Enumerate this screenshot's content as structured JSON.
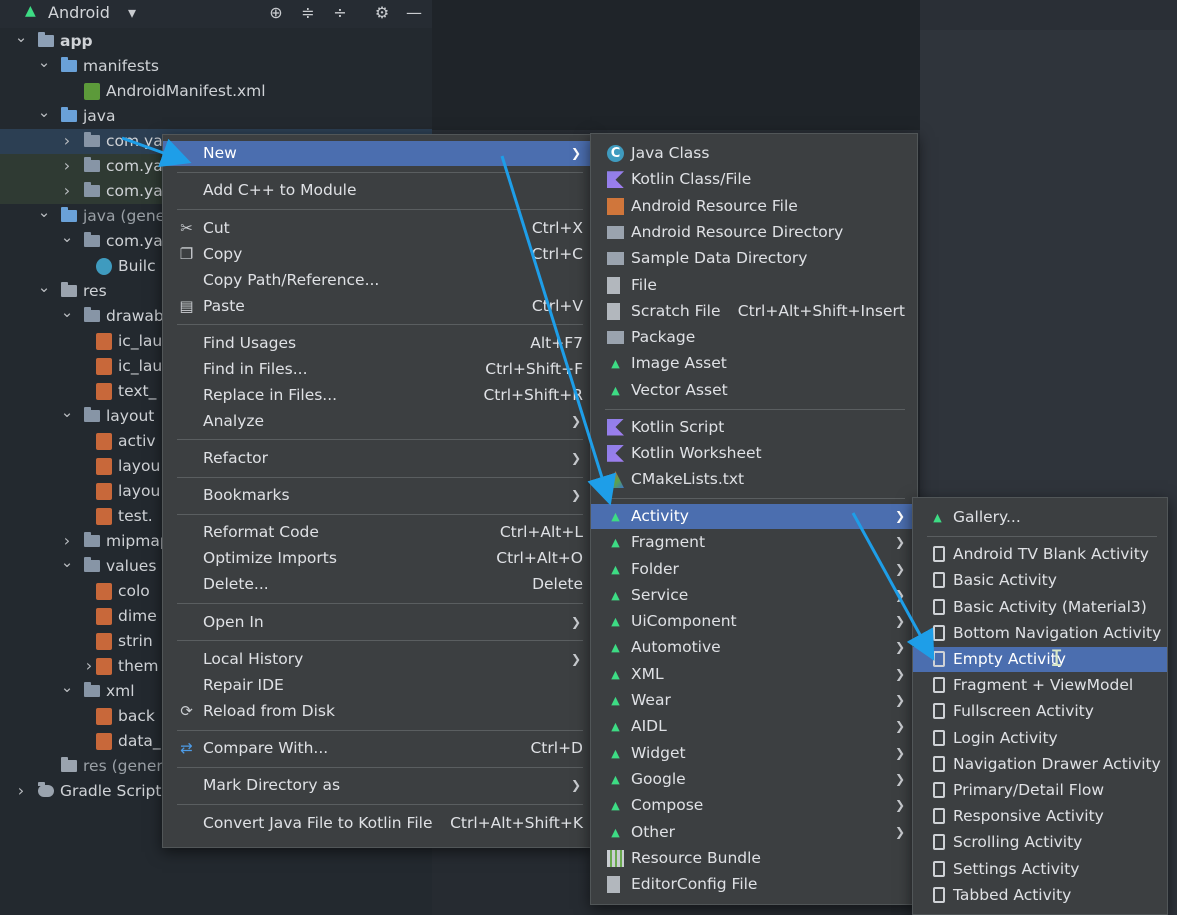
{
  "toolbar": {
    "title": "Android",
    "icons": [
      "android-icon",
      "chevron-down-icon",
      "locate-icon",
      "expand-all-icon",
      "collapse-all-icon",
      "gear-icon",
      "minimize-icon"
    ]
  },
  "tree": [
    {
      "label": "app",
      "level": 0
    },
    {
      "label": "manifests",
      "level": 1
    },
    {
      "label": "AndroidManifest.xml",
      "level": 2
    },
    {
      "label": "java",
      "level": 1
    },
    {
      "label": "com.yar",
      "level": 2
    },
    {
      "label": "com.yar",
      "level": 2
    },
    {
      "label": "com.yar",
      "level": 2
    },
    {
      "label": "java (genera",
      "level": 1
    },
    {
      "label": "com.yar",
      "level": 2
    },
    {
      "label": "Builc",
      "level": 3
    },
    {
      "label": "res",
      "level": 1
    },
    {
      "label": "drawabl",
      "level": 2
    },
    {
      "label": "ic_lau",
      "level": 3
    },
    {
      "label": "ic_lau",
      "level": 3
    },
    {
      "label": "text_",
      "level": 3
    },
    {
      "label": "layout",
      "level": 2
    },
    {
      "label": "activ",
      "level": 3
    },
    {
      "label": "layou",
      "level": 3
    },
    {
      "label": "layou",
      "level": 3
    },
    {
      "label": "test.",
      "level": 3
    },
    {
      "label": "mipmap",
      "level": 2
    },
    {
      "label": "values",
      "level": 2
    },
    {
      "label": "colo",
      "level": 3
    },
    {
      "label": "dime",
      "level": 3
    },
    {
      "label": "strin",
      "level": 3
    },
    {
      "label": "them",
      "level": 3
    },
    {
      "label": "xml",
      "level": 2
    },
    {
      "label": "back",
      "level": 3
    },
    {
      "label": "data_",
      "level": 3
    },
    {
      "label": "res (genera",
      "level": 1
    },
    {
      "label": "Gradle Scripts",
      "level": 0
    }
  ],
  "menu1": {
    "items": [
      {
        "label": "New",
        "submenu": true,
        "selected": true
      },
      {
        "label": "Add C++ to Module"
      },
      {
        "label": "Cut",
        "shortcut": "Ctrl+X",
        "icon": "scissors-icon"
      },
      {
        "label": "Copy",
        "shortcut": "Ctrl+C",
        "icon": "copy-icon"
      },
      {
        "label": "Copy Path/Reference..."
      },
      {
        "label": "Paste",
        "shortcut": "Ctrl+V",
        "icon": "paste-icon"
      },
      {
        "label": "Find Usages",
        "shortcut": "Alt+F7"
      },
      {
        "label": "Find in Files...",
        "shortcut": "Ctrl+Shift+F"
      },
      {
        "label": "Replace in Files...",
        "shortcut": "Ctrl+Shift+R"
      },
      {
        "label": "Analyze",
        "submenu": true
      },
      {
        "label": "Refactor",
        "submenu": true
      },
      {
        "label": "Bookmarks",
        "submenu": true
      },
      {
        "label": "Reformat Code",
        "shortcut": "Ctrl+Alt+L"
      },
      {
        "label": "Optimize Imports",
        "shortcut": "Ctrl+Alt+O"
      },
      {
        "label": "Delete...",
        "shortcut": "Delete"
      },
      {
        "label": "Open In",
        "submenu": true
      },
      {
        "label": "Local History",
        "submenu": true
      },
      {
        "label": "Repair IDE"
      },
      {
        "label": "Reload from Disk",
        "icon": "reload-icon"
      },
      {
        "label": "Compare With...",
        "shortcut": "Ctrl+D",
        "icon": "compare-icon"
      },
      {
        "label": "Mark Directory as",
        "submenu": true
      },
      {
        "label": "Convert Java File to Kotlin File",
        "shortcut": "Ctrl+Alt+Shift+K"
      }
    ]
  },
  "menu2": {
    "items": [
      {
        "label": "Java Class",
        "icon": "java-class-icon"
      },
      {
        "label": "Kotlin Class/File",
        "icon": "kotlin-icon"
      },
      {
        "label": "Android Resource File",
        "icon": "resource-file-icon"
      },
      {
        "label": "Android Resource Directory",
        "icon": "folder-icon"
      },
      {
        "label": "Sample Data Directory",
        "icon": "folder-icon"
      },
      {
        "label": "File",
        "icon": "file-icon"
      },
      {
        "label": "Scratch File",
        "shortcut": "Ctrl+Alt+Shift+Insert",
        "icon": "scratch-file-icon"
      },
      {
        "label": "Package",
        "icon": "package-icon"
      },
      {
        "label": "Image Asset",
        "icon": "android-icon"
      },
      {
        "label": "Vector Asset",
        "icon": "android-icon"
      },
      {
        "label": "Kotlin Script",
        "icon": "kotlin-icon"
      },
      {
        "label": "Kotlin Worksheet",
        "icon": "kotlin-icon"
      },
      {
        "label": "CMakeLists.txt",
        "icon": "cmake-icon"
      },
      {
        "label": "Activity",
        "submenu": true,
        "selected": true,
        "icon": "android-icon"
      },
      {
        "label": "Fragment",
        "submenu": true,
        "icon": "android-icon"
      },
      {
        "label": "Folder",
        "submenu": true,
        "icon": "android-icon"
      },
      {
        "label": "Service",
        "submenu": true,
        "icon": "android-icon"
      },
      {
        "label": "UiComponent",
        "submenu": true,
        "icon": "android-icon"
      },
      {
        "label": "Automotive",
        "submenu": true,
        "icon": "android-icon"
      },
      {
        "label": "XML",
        "submenu": true,
        "icon": "android-icon"
      },
      {
        "label": "Wear",
        "submenu": true,
        "icon": "android-icon"
      },
      {
        "label": "AIDL",
        "submenu": true,
        "icon": "android-icon"
      },
      {
        "label": "Widget",
        "submenu": true,
        "icon": "android-icon"
      },
      {
        "label": "Google",
        "submenu": true,
        "icon": "android-icon"
      },
      {
        "label": "Compose",
        "submenu": true,
        "icon": "android-icon"
      },
      {
        "label": "Other",
        "submenu": true,
        "icon": "android-icon"
      },
      {
        "label": "Resource Bundle",
        "icon": "resource-bundle-icon"
      },
      {
        "label": "EditorConfig File",
        "icon": "editorconfig-icon"
      }
    ]
  },
  "menu3": {
    "items": [
      {
        "label": "Gallery...",
        "icon": "android-icon"
      },
      {
        "label": "Android TV Blank Activity",
        "icon": "phone-icon"
      },
      {
        "label": "Basic Activity",
        "icon": "phone-icon"
      },
      {
        "label": "Basic Activity (Material3)",
        "icon": "phone-icon"
      },
      {
        "label": "Bottom Navigation Activity",
        "icon": "phone-icon"
      },
      {
        "label": "Empty Activity",
        "icon": "phone-icon",
        "selected": true
      },
      {
        "label": "Fragment + ViewModel",
        "icon": "phone-icon"
      },
      {
        "label": "Fullscreen Activity",
        "icon": "phone-icon"
      },
      {
        "label": "Login Activity",
        "icon": "phone-icon"
      },
      {
        "label": "Navigation Drawer Activity",
        "icon": "phone-icon"
      },
      {
        "label": "Primary/Detail Flow",
        "icon": "phone-icon"
      },
      {
        "label": "Responsive Activity",
        "icon": "phone-icon"
      },
      {
        "label": "Scrolling Activity",
        "icon": "phone-icon"
      },
      {
        "label": "Settings Activity",
        "icon": "phone-icon"
      },
      {
        "label": "Tabbed Activity",
        "icon": "phone-icon"
      }
    ]
  },
  "colors": {
    "selection": "#4b6eaf",
    "menu_bg": "#3c3f41",
    "arrow": "#1e9ee8",
    "android_green": "#3ddc84"
  }
}
